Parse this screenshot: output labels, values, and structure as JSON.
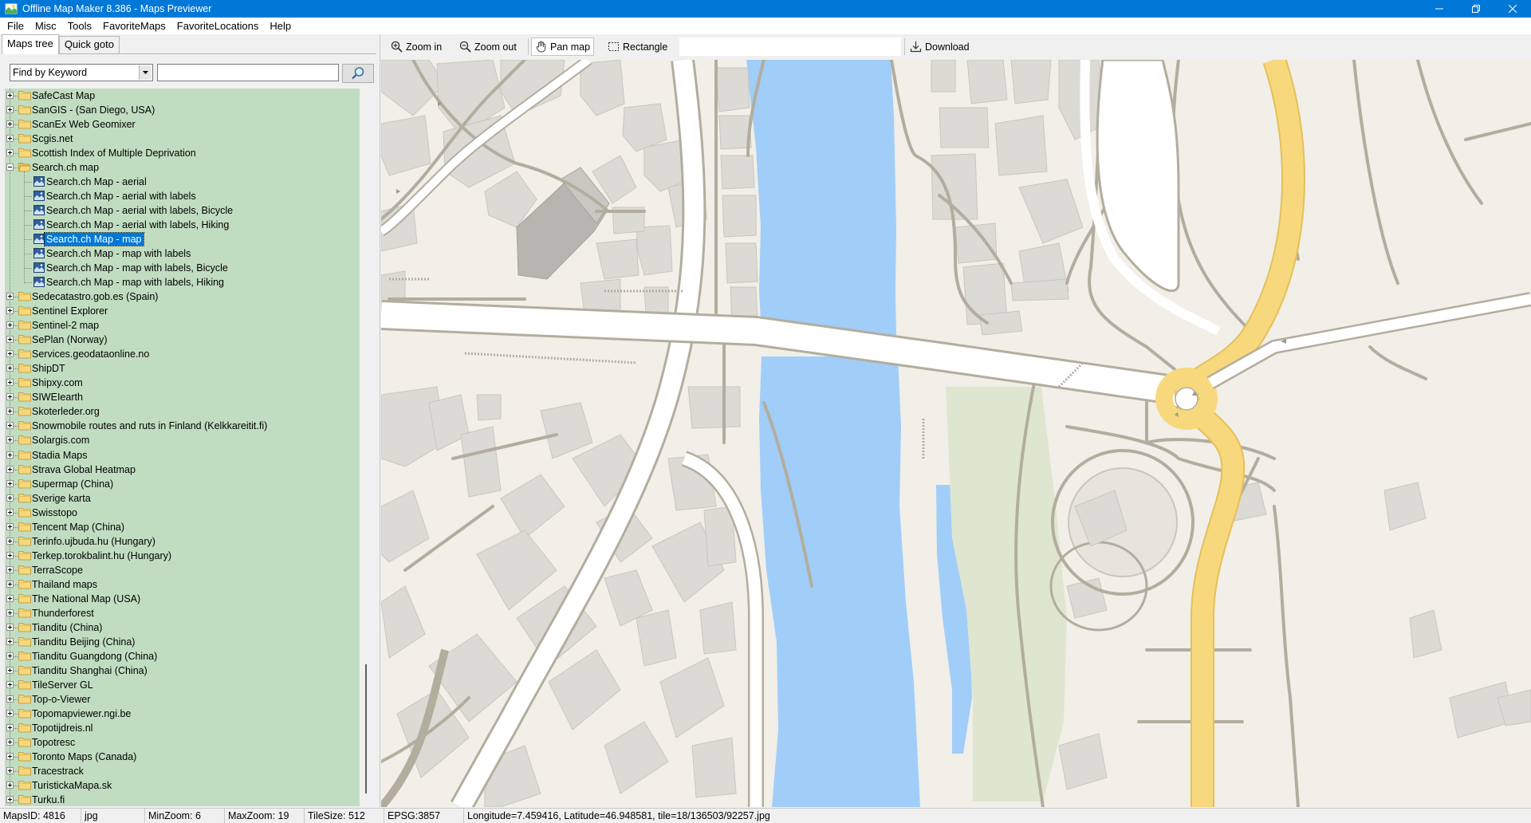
{
  "window": {
    "title": "Offline Map Maker 8.386 - Maps Previewer"
  },
  "menu": {
    "items": [
      "File",
      "Misc",
      "Tools",
      "FavoriteMaps",
      "FavoriteLocations",
      "Help"
    ]
  },
  "tabs": {
    "maps_tree": "Maps tree",
    "quick_goto": "Quick goto"
  },
  "search": {
    "mode": "Find by Keyword",
    "value": ""
  },
  "tree": {
    "items": [
      {
        "label": "SafeCast Map",
        "type": "folder"
      },
      {
        "label": "SanGIS - (San Diego, USA)",
        "type": "folder"
      },
      {
        "label": "ScanEx Web Geomixer",
        "type": "folder"
      },
      {
        "label": "Scgis.net",
        "type": "folder"
      },
      {
        "label": "Scottish Index of Multiple Deprivation",
        "type": "folder"
      },
      {
        "label": "Search.ch map",
        "type": "folder-open"
      },
      {
        "label": "Search.ch Map - aerial",
        "type": "map"
      },
      {
        "label": "Search.ch Map - aerial with labels",
        "type": "map"
      },
      {
        "label": "Search.ch Map - aerial with labels, Bicycle",
        "type": "map"
      },
      {
        "label": "Search.ch Map - aerial with labels, Hiking",
        "type": "map"
      },
      {
        "label": "Search.ch Map - map",
        "type": "map",
        "selected": true
      },
      {
        "label": "Search.ch Map - map with labels",
        "type": "map"
      },
      {
        "label": "Search.ch Map - map with labels, Bicycle",
        "type": "map"
      },
      {
        "label": "Search.ch Map - map with labels, Hiking",
        "type": "map"
      },
      {
        "label": "Sedecatastro.gob.es (Spain)",
        "type": "folder"
      },
      {
        "label": "Sentinel Explorer",
        "type": "folder"
      },
      {
        "label": "Sentinel-2 map",
        "type": "folder"
      },
      {
        "label": "SePlan (Norway)",
        "type": "folder"
      },
      {
        "label": "Services.geodataonline.no",
        "type": "folder"
      },
      {
        "label": "ShipDT",
        "type": "folder"
      },
      {
        "label": "Shipxy.com",
        "type": "folder"
      },
      {
        "label": "SIWEIearth",
        "type": "folder"
      },
      {
        "label": "Skoterleder.org",
        "type": "folder"
      },
      {
        "label": "Snowmobile routes and ruts in Finland (Kelkkareitit.fi)",
        "type": "folder"
      },
      {
        "label": "Solargis.com",
        "type": "folder"
      },
      {
        "label": "Stadia Maps",
        "type": "folder"
      },
      {
        "label": "Strava Global Heatmap",
        "type": "folder"
      },
      {
        "label": "Supermap (China)",
        "type": "folder"
      },
      {
        "label": "Sverige karta",
        "type": "folder"
      },
      {
        "label": "Swisstopo",
        "type": "folder"
      },
      {
        "label": "Tencent Map (China)",
        "type": "folder"
      },
      {
        "label": "Terinfo.ujbuda.hu (Hungary)",
        "type": "folder"
      },
      {
        "label": "Terkep.torokbalint.hu (Hungary)",
        "type": "folder"
      },
      {
        "label": "TerraScope",
        "type": "folder"
      },
      {
        "label": "Thailand maps",
        "type": "folder"
      },
      {
        "label": "The National Map (USA)",
        "type": "folder"
      },
      {
        "label": "Thunderforest",
        "type": "folder"
      },
      {
        "label": "Tianditu (China)",
        "type": "folder"
      },
      {
        "label": "Tianditu Beijing (China)",
        "type": "folder"
      },
      {
        "label": "Tianditu Guangdong (China)",
        "type": "folder"
      },
      {
        "label": "Tianditu Shanghai (China)",
        "type": "folder"
      },
      {
        "label": "TileServer GL",
        "type": "folder"
      },
      {
        "label": "Top-o-Viewer",
        "type": "folder"
      },
      {
        "label": "Topomapviewer.ngi.be",
        "type": "folder"
      },
      {
        "label": "Topotijdreis.nl",
        "type": "folder"
      },
      {
        "label": "Topotresc",
        "type": "folder"
      },
      {
        "label": "Toronto Maps (Canada)",
        "type": "folder"
      },
      {
        "label": "Tracestrack",
        "type": "folder"
      },
      {
        "label": "TuristickaMapa.sk",
        "type": "folder"
      },
      {
        "label": "Turku.fi",
        "type": "folder"
      }
    ]
  },
  "toolbar": {
    "zoom_in": "Zoom in",
    "zoom_out": "Zoom out",
    "pan_map": "Pan map",
    "rectangle": "Rectangle",
    "download": "Download",
    "active_tool": "pan_map"
  },
  "colors": {
    "titlebar": "#0078d7",
    "tree_bg": "#c1ddc1",
    "selection": "#0078d7",
    "water": "#a1cdf9",
    "land": "#f1efe8",
    "building": "#dcdad5",
    "park": "#dfe6d0",
    "highway": "#f8d87c"
  },
  "status": {
    "maps_id": "MapsID: 4816",
    "format": "jpg",
    "min_zoom": "MinZoom: 6",
    "max_zoom": "MaxZoom: 19",
    "tile_size": "TileSize: 512",
    "epsg": "EPSG:3857",
    "coords": "Longitude=7.459416, Latitude=46.948581, tile=18/136503/92257.jpg"
  }
}
